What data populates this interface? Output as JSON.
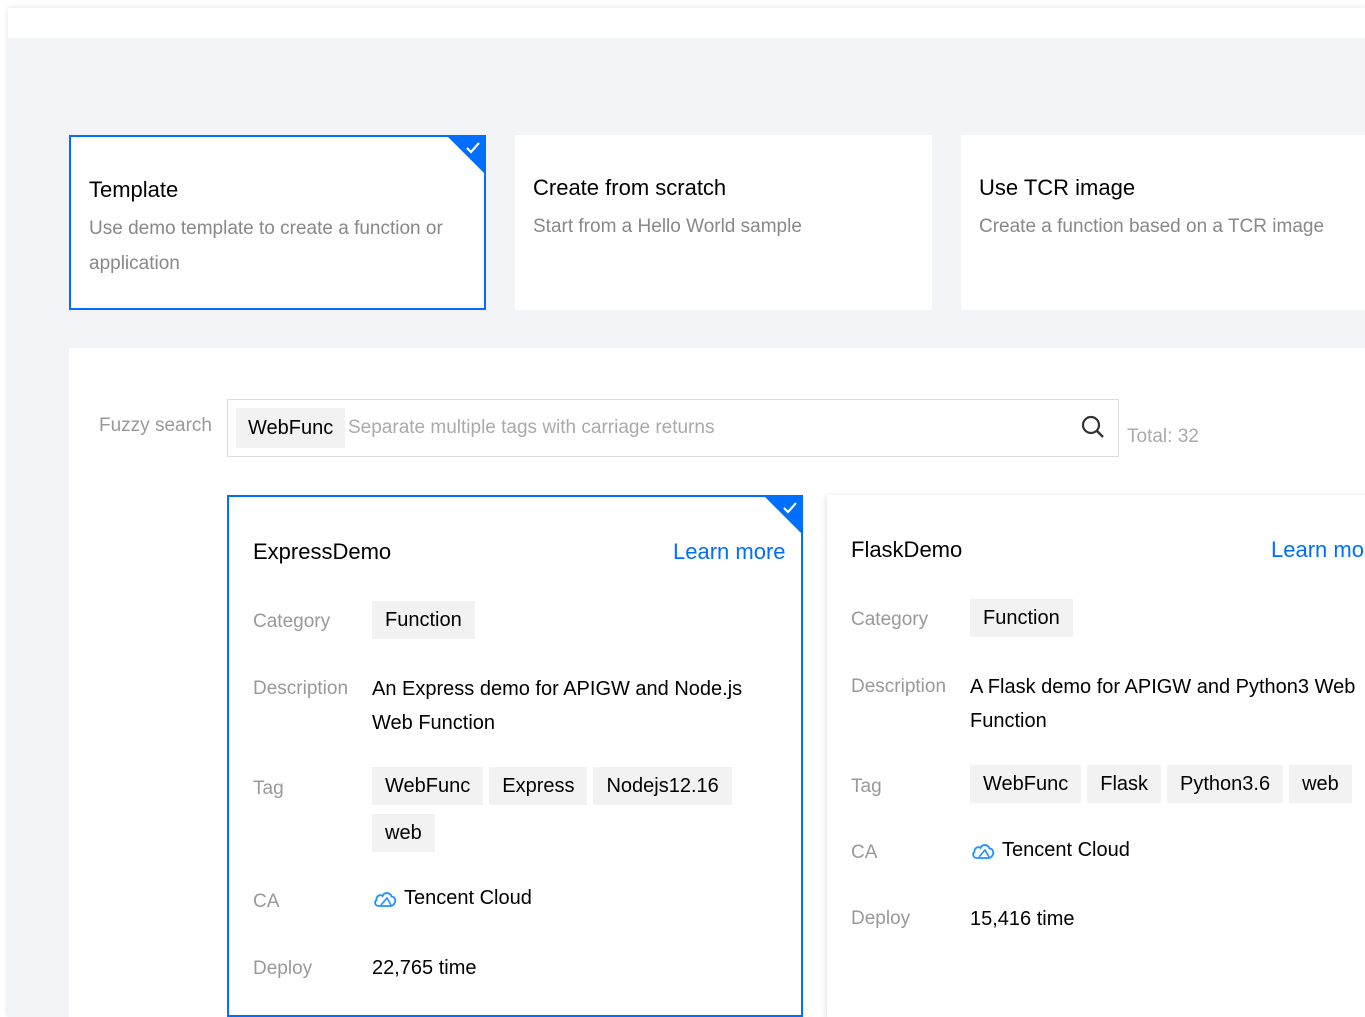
{
  "modes": [
    {
      "title": "Template",
      "desc": "Use demo template to create a function or application"
    },
    {
      "title": "Create from scratch",
      "desc": "Start from a Hello World sample"
    },
    {
      "title": "Use TCR image",
      "desc": "Create a function based on a TCR image"
    }
  ],
  "search": {
    "label": "Fuzzy search",
    "chip": "WebFunc",
    "placeholder": "Separate multiple tags with carriage returns",
    "total": "Total: 32"
  },
  "labels": {
    "category": "Category",
    "description": "Description",
    "tag": "Tag",
    "ca": "CA",
    "deploy": "Deploy"
  },
  "templates": [
    {
      "name": "ExpressDemo",
      "learn_more": "Learn more",
      "category": "Function",
      "description": "An Express demo for APIGW and Node.js Web Function",
      "tags": [
        "WebFunc",
        "Express",
        "Nodejs12.16",
        "web"
      ],
      "ca": "Tencent Cloud",
      "deploy": "22,765 time"
    },
    {
      "name": "FlaskDemo",
      "learn_more": "Learn more",
      "category": "Function",
      "description": "A Flask demo for APIGW and Python3 Web Function",
      "tags": [
        "WebFunc",
        "Flask",
        "Python3.6",
        "web"
      ],
      "ca": "Tencent Cloud",
      "deploy": "15,416 time"
    }
  ],
  "colors": {
    "accent": "#006eff"
  }
}
